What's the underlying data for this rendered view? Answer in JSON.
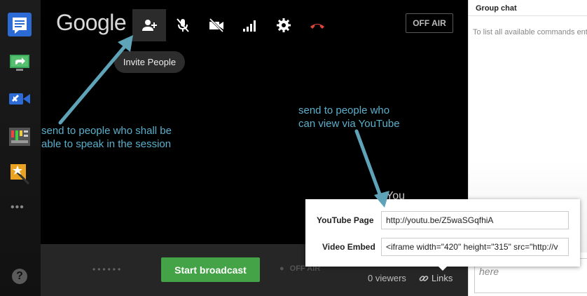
{
  "brand": "Google",
  "toolbar": {
    "tooltip": "Invite People",
    "off_air_label": "OFF AIR"
  },
  "annotations": {
    "speak_line1": "send to people who shall be",
    "speak_line2": "able to speak in the session",
    "youtube_line1": "send to people who",
    "youtube_line2": "can view via YouTube"
  },
  "stage": {
    "you_label": "You"
  },
  "bottombar": {
    "dots": "••••••",
    "start_label": "Start broadcast",
    "status_dot": "●",
    "status_label": "OFF AIR",
    "viewers": "0 viewers",
    "links_label": "Links"
  },
  "popup": {
    "youtube_label": "YouTube Page",
    "youtube_value": "http://youtu.be/Z5waSGqfhiA",
    "embed_label": "Video Embed",
    "embed_value": "<iframe width=\"420\" height=\"315\" src=\"http://v"
  },
  "chat": {
    "title": "Group chat",
    "info": "To list all available commands enter",
    "input_placeholder": "here"
  },
  "sidebar": {
    "help": "?",
    "more": "•••"
  },
  "colors": {
    "accent_green": "#43a346",
    "annotation": "#5ab0cc",
    "hangup_red": "#e0453a"
  }
}
